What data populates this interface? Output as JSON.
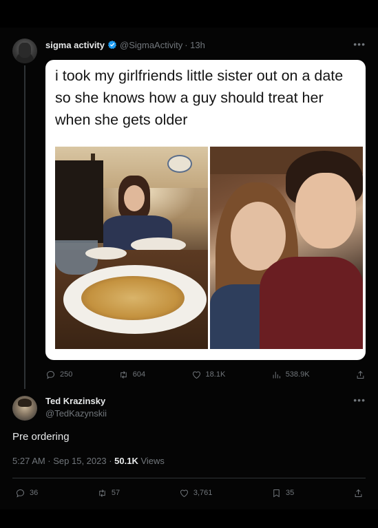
{
  "tweet": {
    "author_name": "sigma activity",
    "author_handle": "@SigmaActivity",
    "time_ago": "· 13h",
    "more_icon": "•••",
    "meme_text": "i took my girlfriends little sister out on a date so she knows how a guy should treat her when she gets older",
    "stats": {
      "replies": "250",
      "retweets": "604",
      "likes": "18.1K",
      "views": "538.9K"
    }
  },
  "reply": {
    "author_name": "Ted Krazinsky",
    "author_handle": "@TedKazynskii",
    "more_icon": "•••",
    "text": "Pre ordering",
    "timestamp": "5:27 AM · Sep 15, 2023 · ",
    "views_count": "50.1K",
    "views_label": " Views",
    "stats": {
      "replies": "36",
      "retweets": "57",
      "likes": "3,761",
      "bookmarks": "35"
    }
  },
  "colors": {
    "background": "#000000",
    "text_primary": "#e7e9ea",
    "text_secondary": "#71767b",
    "verified_blue": "#1d9bf0",
    "divider": "#2f3336"
  },
  "icons": [
    "verified-badge-icon",
    "reply-icon",
    "retweet-icon",
    "like-icon",
    "views-icon",
    "share-icon",
    "bookmark-icon",
    "more-icon"
  ]
}
